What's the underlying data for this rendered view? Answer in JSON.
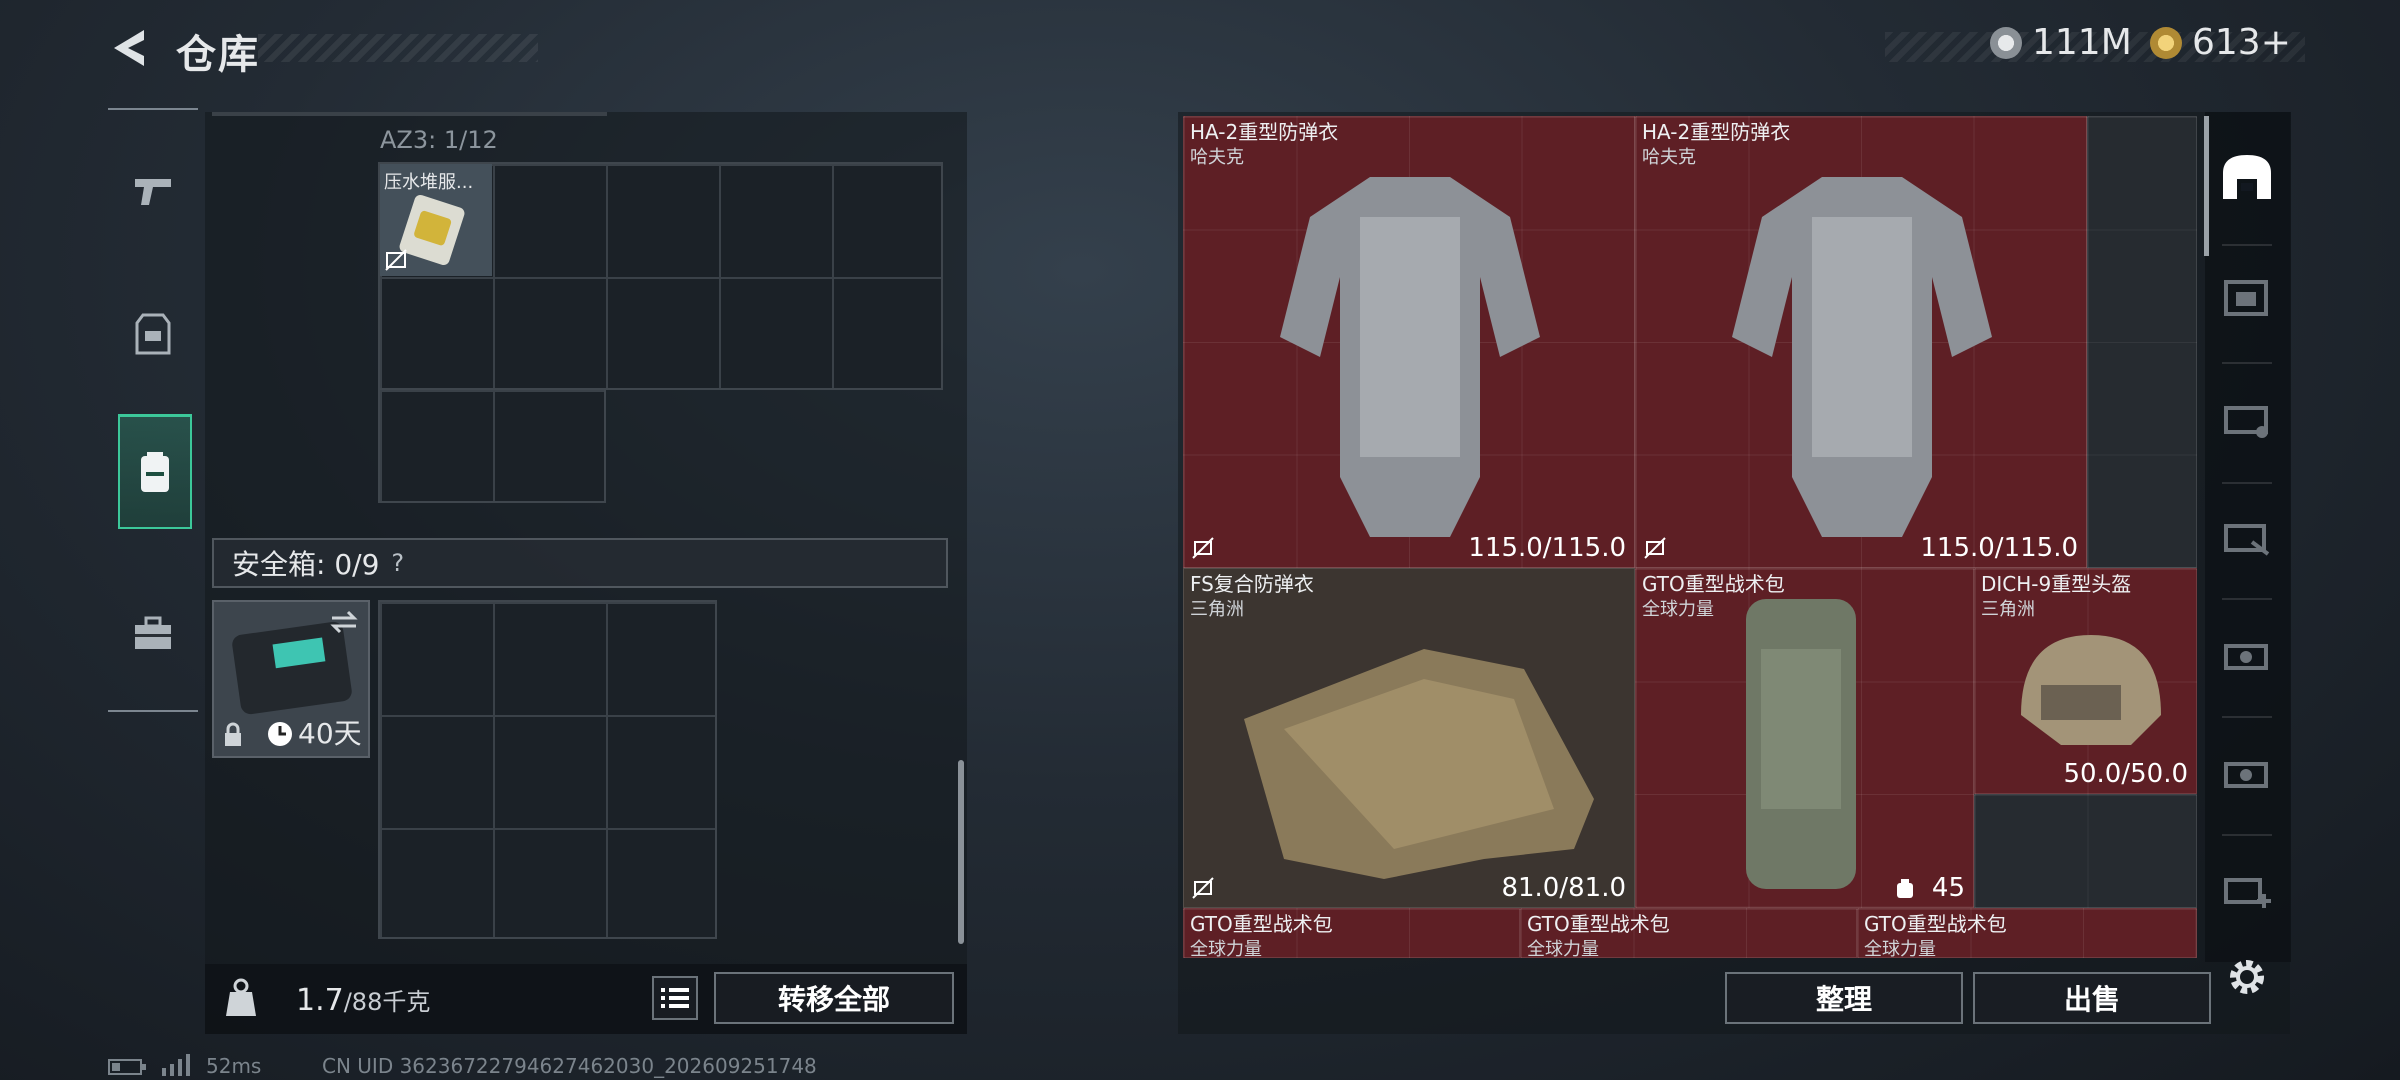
{
  "header": {
    "title": "仓库",
    "currency1": "111M",
    "currency2": "613+"
  },
  "nav": {
    "items": [
      "weapon",
      "armor",
      "backpack",
      "toolbox"
    ],
    "active": "backpack"
  },
  "left": {
    "container_label": "AZ3: 1/12",
    "item_name": "压水堆服...",
    "safebox_label": "安全箱: 0/9",
    "safebox_help": "?",
    "safecase_timer": "40天",
    "weight_value": "1.7",
    "weight_unit": "/88千克",
    "transfer_label": "转移全部"
  },
  "items": [
    {
      "name": "HA-2重型防弹衣",
      "sub": "哈夫克",
      "durability": "115.0/115.0"
    },
    {
      "name": "HA-2重型防弹衣",
      "sub": "哈夫克",
      "durability": "115.0/115.0"
    },
    {
      "name": "FS复合防弹衣",
      "sub": "三角洲",
      "durability": "81.0/81.0"
    },
    {
      "name": "GTO重型战术包",
      "sub": "全球力量",
      "count": "45"
    },
    {
      "name": "DICH-9重型头盔",
      "sub": "三角洲",
      "durability": "50.0/50.0"
    },
    {
      "name": "GTO重型战术包",
      "sub": "全球力量"
    },
    {
      "name": "GTO重型战术包",
      "sub": "全球力量"
    },
    {
      "name": "GTO重型战术包",
      "sub": "全球力量"
    }
  ],
  "right_actions": {
    "organize": "整理",
    "sell": "出售"
  },
  "status": {
    "ping": "52ms",
    "uid": "CN UID 36236722794627462030_202609251748"
  },
  "colors": {
    "accent": "#3cc89a",
    "item_red": "#5e1f25"
  }
}
